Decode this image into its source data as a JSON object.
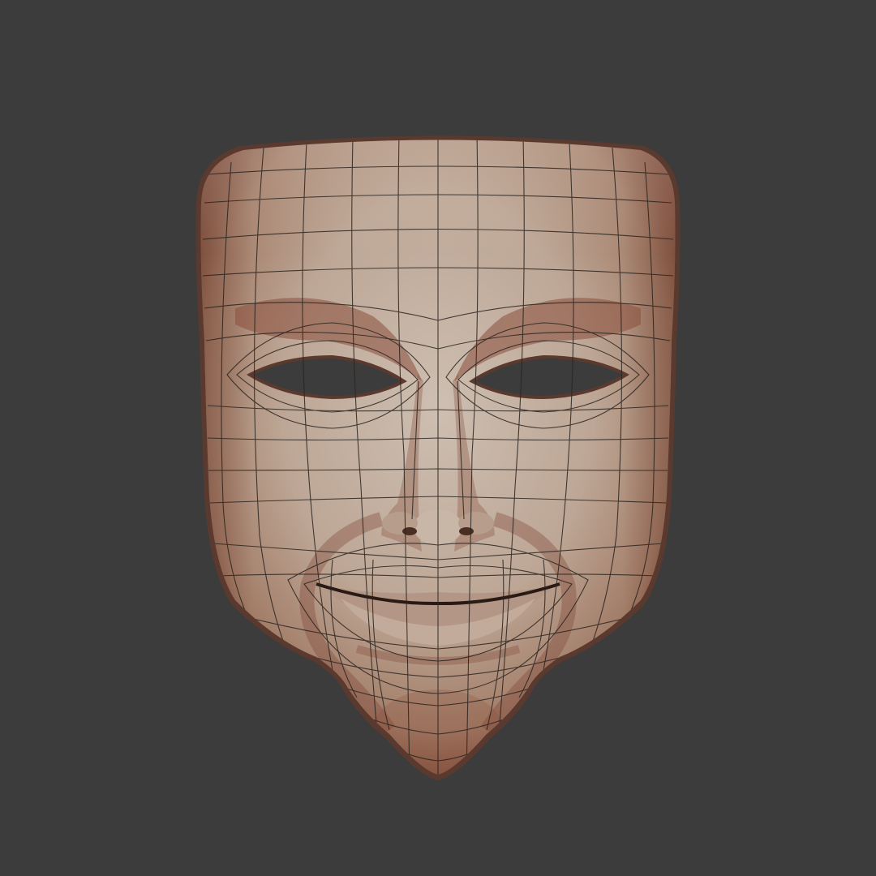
{
  "scene": {
    "subject_icon": "mask-icon",
    "colors": {
      "background": "#3c3c3c",
      "skin_light": "#cbbcae",
      "skin_mid": "#b59c8a",
      "skin_shadow": "#8a4f3c",
      "wire": "#2a241f"
    }
  }
}
